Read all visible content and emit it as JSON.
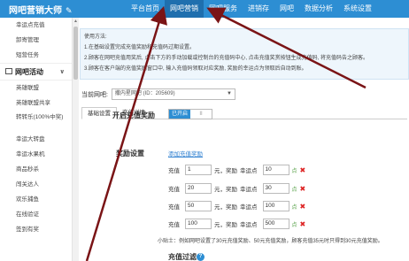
{
  "header": {
    "brand": "网吧营销大师",
    "brand_icon": "pencil-icon",
    "nav": [
      "平台首页",
      "网吧营销",
      "网吧服务",
      "进销存",
      "网吧",
      "数据分析",
      "系统设置"
    ],
    "active_nav": "网吧营销",
    "color": "#2d8ed3"
  },
  "sidebar": {
    "top_items": [
      "幸运点充值",
      "卸寄管理",
      "短营任务"
    ],
    "group": {
      "label": "网吧活动",
      "icon": "gamepad-icon",
      "caret": "∨"
    },
    "items": [
      "英雄联盟",
      "英雄联盟共享",
      "转转乐(100%中奖)",
      "幸运大转盘",
      "幸运水果机",
      "商品秒杀",
      "闯关达人",
      "欢乐捕鱼",
      "在线验证",
      "签到有奖"
    ]
  },
  "help": {
    "lines": [
      "使用方法:",
      "1.在基础设置完成充值奖励和充值码过期设置。",
      "2.顾客在网吧充值用奖后, 点击下方的手动加载或控制台的充值码中心, 点击充值奖赏按钮生成充值码, 将充值码告之顾客。",
      "3.顾客在客户端的充值奖励窗口中, 输入充值码领取对应奖励, 奖励的幸运点为领取后自动到账。"
    ]
  },
  "current": {
    "label": "当前网吧:",
    "value": "撒内星网吧 (ID：205609)"
  },
  "tabs": [
    "基础设置",
    "充值详情"
  ],
  "settings": {
    "enable_label": "开启充值奖励",
    "toggle_on": "已开启",
    "toggle_off": "II",
    "reward_label": "奖励设置",
    "add_link": "添加充值奖励",
    "rows": [
      {
        "recharge": "1",
        "points": "10"
      },
      {
        "recharge": "20",
        "points": "30"
      },
      {
        "recharge": "50",
        "points": "100"
      },
      {
        "recharge": "100",
        "points": "500"
      }
    ],
    "text_recharge": "充值",
    "text_yuan": "元，奖励",
    "text_lucky": "幸运点",
    "text_point": "点",
    "del_symbol": "✖",
    "tip": "小贴士：例如网吧设置了30元充值奖励、50元充值奖励，顾客充值35元时只得到30元充值奖励。",
    "bottom_label": "充值过滤",
    "help_symbol": "?"
  }
}
